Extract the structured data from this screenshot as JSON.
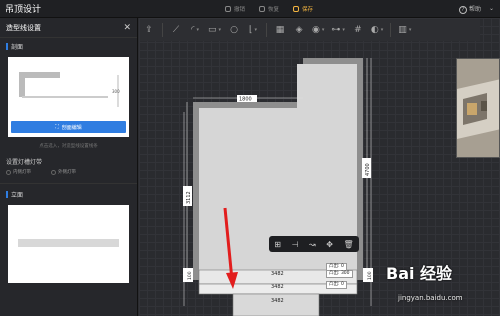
{
  "header": {
    "title": "吊顶设计",
    "actions": [
      {
        "label": "撤销",
        "active": false
      },
      {
        "label": "恢复",
        "active": false
      },
      {
        "label": "保存",
        "active": true
      }
    ],
    "help_label": "帮助",
    "help_caret": "⌄"
  },
  "panel": {
    "title": "造型线设置",
    "close_glyph": "✕",
    "section_profile": "剖面",
    "edit_button": "剖面编辑",
    "hint": "点击选入，对造型线设置线条",
    "light_title": "设置灯槽灯带",
    "light_options": [
      "内侧灯带",
      "外侧灯带"
    ],
    "section_elevation": "立面",
    "profile_dim": "300"
  },
  "toolbar": {
    "tools": [
      "export-icon",
      "line-icon",
      "arc-icon",
      "rect-icon",
      "circle-icon",
      "corner-icon",
      "grid-icon",
      "layer-icon",
      "eye-icon",
      "align-icon",
      "hash-icon",
      "style-icon",
      "book-icon"
    ]
  },
  "floorplan": {
    "dims": {
      "top_left": "1800",
      "left": "3112",
      "right": "4700",
      "bottom_a": "3482",
      "bottom_b": "3482",
      "bottom_c": "3482",
      "tag_a": "凸出: 0",
      "tag_b": "凸出: 300",
      "tag_c": "凸出: 0",
      "edge_small_left": "100",
      "edge_small_right": "100"
    }
  },
  "watermark": {
    "brand": "Bai 经验",
    "url": "jingyan.baidu.com"
  },
  "colors": {
    "accent_blue": "#2f7de1",
    "accent_yellow": "#f4b540",
    "arrow_red": "#e21d1d"
  }
}
